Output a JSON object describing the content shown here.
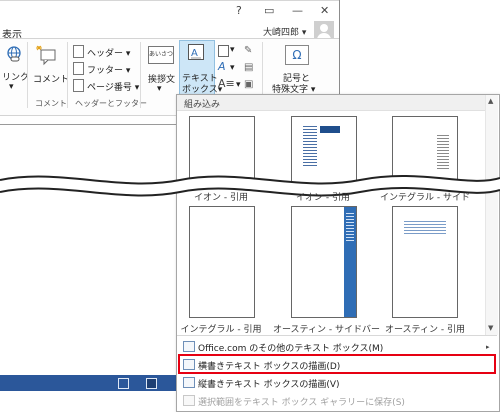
{
  "titlebar": {
    "help": "?",
    "restore": "▭",
    "minimize": "—",
    "close": "✕"
  },
  "tabs": {
    "view": "表示"
  },
  "user": {
    "name": "大崎四郎"
  },
  "ribbon": {
    "link": "リンク",
    "comment": "コメント",
    "comment_group": "コメント",
    "header": "ヘッダー",
    "footer": "フッター",
    "page_number": "ページ番号",
    "header_footer_group": "ヘッダーとフッター",
    "greeting": "挨拶文",
    "greeting_icon_text": "あいさつ",
    "textbox_line1": "テキスト",
    "textbox_line2": "ボックス",
    "symbol_line1": "記号と",
    "symbol_line2": "特殊文字",
    "omega": "Ω",
    "dropdown_arrow": "▾"
  },
  "gallery": {
    "header": "組み込み",
    "row1": [
      "イオン - 引用",
      "イオン - 引用",
      "インテグラル - サイド"
    ],
    "row2": [
      "インテグラル - 引用",
      "オースティン - サイドバー",
      "オースティン - 引用"
    ]
  },
  "menu": {
    "more_textboxes": "Office.com のその他のテキスト ボックス(M)",
    "draw_horizontal": "横書きテキスト ボックスの描画(D)",
    "draw_vertical": "縦書きテキスト ボックスの描画(V)",
    "save_selection": "選択範囲をテキスト ボックス ギャラリーに保存(S)",
    "submenu_arrow": "▸"
  },
  "colors": {
    "statusbar": "#2b579a",
    "highlight": "#e60012",
    "active_button": "#cde6f7"
  }
}
